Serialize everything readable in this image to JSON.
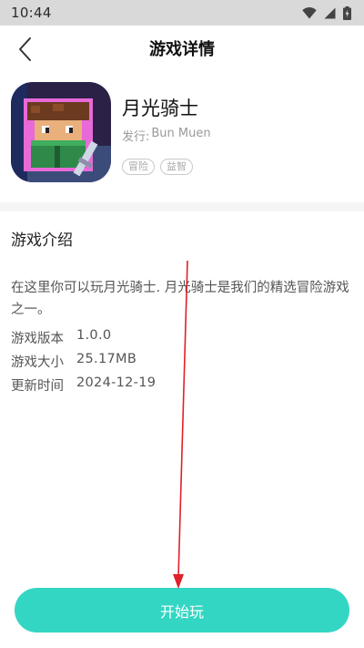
{
  "status_bar": {
    "time": "10:44",
    "icons": [
      "wifi-icon",
      "signal-icon",
      "battery-icon"
    ]
  },
  "nav": {
    "title": "游戏详情",
    "back_icon": "chevron-left-icon"
  },
  "game": {
    "name": "月光骑士",
    "publisher_label": "发行:",
    "publisher": "Bun Muen",
    "tags": [
      "冒险",
      "益智"
    ]
  },
  "intro": {
    "title": "游戏介绍",
    "description": "在这里你可以玩月光骑士. 月光骑士是我们的精选冒险游戏之一。",
    "details": [
      {
        "label": "游戏版本",
        "value": "1.0.0"
      },
      {
        "label": "游戏大小",
        "value": "25.17MB"
      },
      {
        "label": "更新时间",
        "value": "2024-12-19"
      }
    ]
  },
  "action": {
    "start_label": "开始玩"
  },
  "colors": {
    "accent": "#33d6c3",
    "status_bar": "#d9d9d9",
    "annotation_arrow": "#e0202a"
  }
}
